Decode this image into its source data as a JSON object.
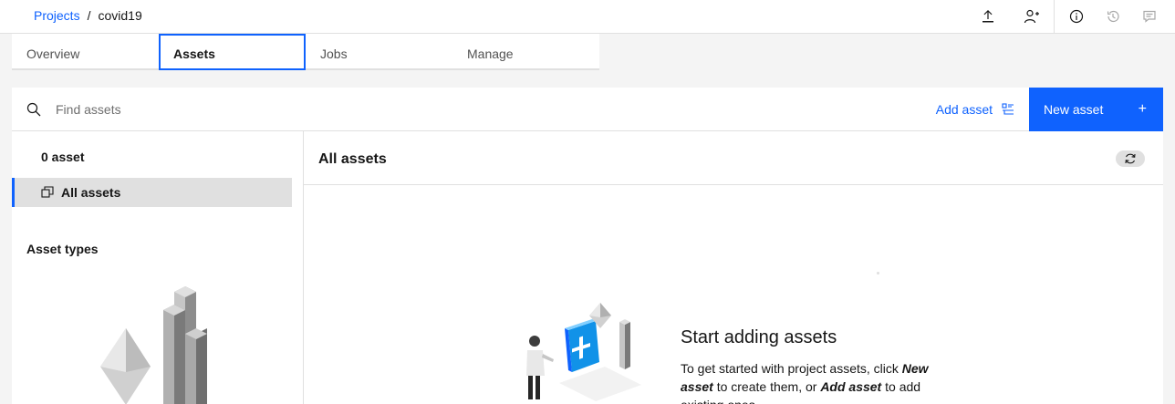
{
  "header": {
    "breadcrumb_root": "Projects",
    "breadcrumb_sep": "/",
    "breadcrumb_current": "covid19"
  },
  "tabs": [
    {
      "label": "Overview"
    },
    {
      "label": "Assets"
    },
    {
      "label": "Jobs"
    },
    {
      "label": "Manage"
    }
  ],
  "search": {
    "placeholder": "Find assets"
  },
  "toolbar": {
    "add_asset_label": "Add asset",
    "new_asset_label": "New asset",
    "new_asset_plus": "+"
  },
  "sidebar": {
    "count_label": "0 asset",
    "all_assets_label": "All assets",
    "asset_types_label": "Asset types"
  },
  "content": {
    "title": "All assets",
    "empty_title": "Start adding assets",
    "empty_desc_1": "To get started with project assets, click ",
    "empty_desc_new": "New asset",
    "empty_desc_2": " to create them, or ",
    "empty_desc_add": "Add asset",
    "empty_desc_3": " to add existing ones."
  },
  "colors": {
    "accent": "#0f62fe",
    "background": "#f4f4f4"
  }
}
